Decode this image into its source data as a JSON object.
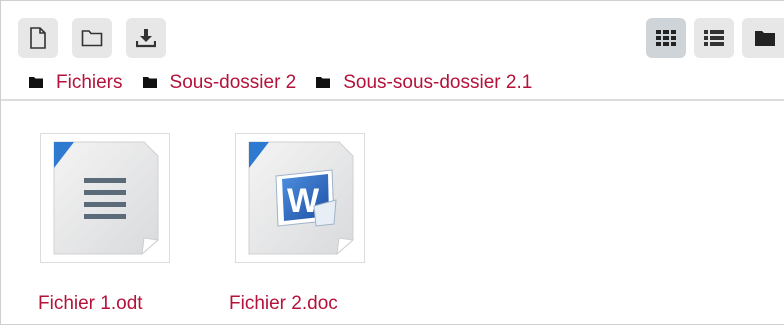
{
  "toolbar": {
    "buttons": [
      {
        "icon": "new-file-icon"
      },
      {
        "icon": "new-folder-icon"
      },
      {
        "icon": "download-icon"
      }
    ],
    "view_buttons": [
      {
        "icon": "grid-view-icon",
        "active": true
      },
      {
        "icon": "list-view-icon",
        "active": false
      },
      {
        "icon": "tree-view-icon",
        "active": false
      }
    ]
  },
  "breadcrumb": {
    "items": [
      {
        "label": "Fichiers",
        "icon": "folder-icon"
      },
      {
        "label": "Sous-dossier 2",
        "icon": "folder-icon"
      },
      {
        "label": "Sous-sous-dossier 2.1",
        "icon": "folder-icon"
      }
    ]
  },
  "files": [
    {
      "name": "Fichier 1.odt",
      "icon": "odt-document-icon"
    },
    {
      "name": "Fichier 2.doc",
      "icon": "word-document-icon"
    }
  ],
  "colors": {
    "link": "#b5123b",
    "button_bg": "#e7e7e7",
    "button_active_bg": "#cfd4d8",
    "icon": "#333333",
    "doc_corner": "#2f7ad1"
  }
}
